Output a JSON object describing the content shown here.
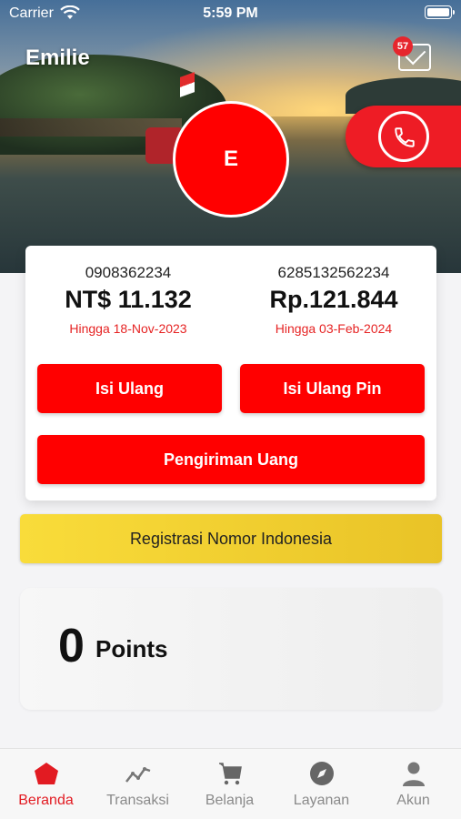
{
  "status_bar": {
    "carrier": "Carrier",
    "time": "5:59 PM"
  },
  "header": {
    "username": "Emilie",
    "mail_badge": "57",
    "avatar_initial": "E"
  },
  "accounts": [
    {
      "number": "0908362234",
      "balance": "NT$ 11.132",
      "expiry": "Hingga 18-Nov-2023"
    },
    {
      "number": "6285132562234",
      "balance": "Rp.121.844",
      "expiry": "Hingga 03-Feb-2024"
    }
  ],
  "buttons": {
    "topup": "Isi Ulang",
    "topup_pin": "Isi Ulang Pin",
    "transfer": "Pengiriman Uang"
  },
  "registration": "Registrasi Nomor Indonesia",
  "points": {
    "value": "0",
    "label": "Points"
  },
  "tabs": [
    {
      "label": "Beranda",
      "icon": "home-icon"
    },
    {
      "label": "Transaksi",
      "icon": "chart-icon"
    },
    {
      "label": "Belanja",
      "icon": "cart-icon"
    },
    {
      "label": "Layanan",
      "icon": "compass-icon"
    },
    {
      "label": "Akun",
      "icon": "user-icon"
    }
  ],
  "colors": {
    "brand_red": "#ff0000",
    "registration_yellow": "#f4d23a",
    "active_tab": "#e21b22"
  }
}
